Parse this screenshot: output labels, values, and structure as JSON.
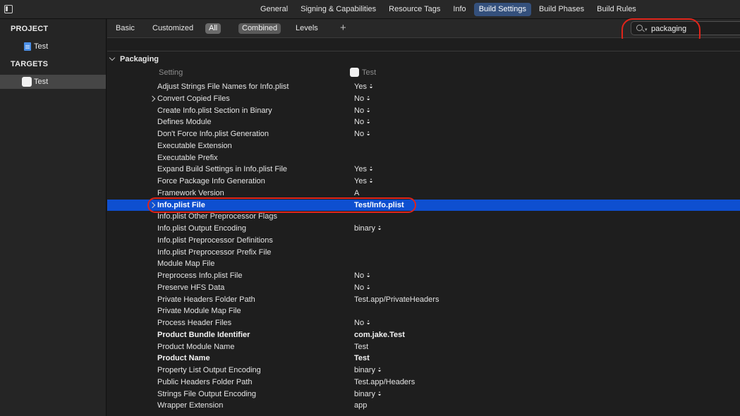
{
  "top_tabs": [
    {
      "label": "General",
      "active": false
    },
    {
      "label": "Signing & Capabilities",
      "active": false
    },
    {
      "label": "Resource Tags",
      "active": false
    },
    {
      "label": "Info",
      "active": false
    },
    {
      "label": "Build Settings",
      "active": true
    },
    {
      "label": "Build Phases",
      "active": false
    },
    {
      "label": "Build Rules",
      "active": false
    }
  ],
  "sidebar": {
    "project_header": "PROJECT",
    "project_item": "Test",
    "targets_header": "TARGETS",
    "target_item": "Test"
  },
  "filter_bar": {
    "basic": "Basic",
    "customized": "Customized",
    "all": "All",
    "combined": "Combined",
    "levels": "Levels",
    "add": "+"
  },
  "search": {
    "value": "packaging"
  },
  "section": {
    "title": "Packaging",
    "col_setting": "Setting",
    "col_target": "Test"
  },
  "settings": [
    {
      "name": "Adjust Strings File Names for Info.plist",
      "value": "Yes",
      "stepper": true
    },
    {
      "name": "Convert Copied Files",
      "value": "No",
      "stepper": true,
      "expandable": true
    },
    {
      "name": "Create Info.plist Section in Binary",
      "value": "No",
      "stepper": true
    },
    {
      "name": "Defines Module",
      "value": "No",
      "stepper": true
    },
    {
      "name": "Don't Force Info.plist Generation",
      "value": "No",
      "stepper": true
    },
    {
      "name": "Executable Extension",
      "value": ""
    },
    {
      "name": "Executable Prefix",
      "value": ""
    },
    {
      "name": "Expand Build Settings in Info.plist File",
      "value": "Yes",
      "stepper": true
    },
    {
      "name": "Force Package Info Generation",
      "value": "Yes",
      "stepper": true
    },
    {
      "name": "Framework Version",
      "value": "A"
    },
    {
      "name": "Info.plist File",
      "value": "Test/Info.plist",
      "selected": true,
      "expandable": true
    },
    {
      "name": "Info.plist Other Preprocessor Flags",
      "value": ""
    },
    {
      "name": "Info.plist Output Encoding",
      "value": "binary",
      "stepper": true
    },
    {
      "name": "Info.plist Preprocessor Definitions",
      "value": ""
    },
    {
      "name": "Info.plist Preprocessor Prefix File",
      "value": ""
    },
    {
      "name": "Module Map File",
      "value": ""
    },
    {
      "name": "Preprocess Info.plist File",
      "value": "No",
      "stepper": true
    },
    {
      "name": "Preserve HFS Data",
      "value": "No",
      "stepper": true
    },
    {
      "name": "Private Headers Folder Path",
      "value": "Test.app/PrivateHeaders"
    },
    {
      "name": "Private Module Map File",
      "value": ""
    },
    {
      "name": "Process Header Files",
      "value": "No",
      "stepper": true
    },
    {
      "name": "Product Bundle Identifier",
      "value": "com.jake.Test",
      "bold": true
    },
    {
      "name": "Product Module Name",
      "value": "Test"
    },
    {
      "name": "Product Name",
      "value": "Test",
      "bold": true
    },
    {
      "name": "Property List Output Encoding",
      "value": "binary",
      "stepper": true
    },
    {
      "name": "Public Headers Folder Path",
      "value": "Test.app/Headers"
    },
    {
      "name": "Strings File Output Encoding",
      "value": "binary",
      "stepper": true
    },
    {
      "name": "Wrapper Extension",
      "value": "app"
    }
  ],
  "colors": {
    "selection": "#0e4fd0",
    "annotation": "#e0241a",
    "active_tab": "#34507c"
  }
}
